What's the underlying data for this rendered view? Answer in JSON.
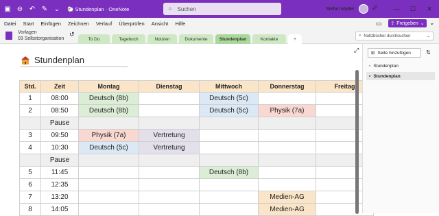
{
  "app": {
    "title": "Stundenplan",
    "app_name": "OneNote",
    "separator": "·"
  },
  "search": {
    "placeholder": "Suchen"
  },
  "user": {
    "name": "Stefan Malter"
  },
  "menu": [
    "Datei",
    "Start",
    "Einfügen",
    "Zeichnen",
    "Verlauf",
    "Überprüfen",
    "Ansicht",
    "Hilfe"
  ],
  "share_label": "Freigeben",
  "notebook": {
    "line1": "Vorlagen",
    "line2": "03 Selbstorganisation"
  },
  "tabs": [
    {
      "label": "To Do",
      "color": "#cfe8c4"
    },
    {
      "label": "Tagebuch",
      "color": "#cfe8c4"
    },
    {
      "label": "Notizen",
      "color": "#cfe8c4"
    },
    {
      "label": "Dokumente",
      "color": "#cfe8c4"
    },
    {
      "label": "Stundenplan",
      "color": "#a9d89a",
      "active": true
    },
    {
      "label": "Kontakte",
      "color": "#cfe8c4"
    },
    {
      "label": "+",
      "color": "#ffffff"
    }
  ],
  "notebook_search": {
    "placeholder": "Notizbücher durchsuchen"
  },
  "page": {
    "title": "Stundenplan"
  },
  "table": {
    "headers": [
      "Std.",
      "Zeit",
      "Montag",
      "Dienstag",
      "Mittwoch",
      "Donnerstag",
      "Freitag"
    ],
    "rows": [
      {
        "std": "1",
        "zeit": "08:00",
        "cells": [
          {
            "t": "Deutsch (8b)",
            "c": "green"
          },
          {
            "t": "",
            "c": ""
          },
          {
            "t": "Deutsch (5c)",
            "c": "blue"
          },
          {
            "t": "",
            "c": ""
          },
          {
            "t": "",
            "c": ""
          }
        ]
      },
      {
        "std": "2",
        "zeit": "08:50",
        "cells": [
          {
            "t": "Deutsch (8b)",
            "c": "green"
          },
          {
            "t": "",
            "c": ""
          },
          {
            "t": "Deutsch (5c)",
            "c": "blue"
          },
          {
            "t": "Physik (7a)",
            "c": "red"
          },
          {
            "t": "",
            "c": ""
          }
        ]
      },
      {
        "pause": true,
        "zeit": "Pause"
      },
      {
        "std": "3",
        "zeit": "09:50",
        "cells": [
          {
            "t": "Physik (7a)",
            "c": "red"
          },
          {
            "t": "Vertretung",
            "c": "purple"
          },
          {
            "t": "",
            "c": ""
          },
          {
            "t": "",
            "c": ""
          },
          {
            "t": "",
            "c": ""
          }
        ]
      },
      {
        "std": "4",
        "zeit": "10:30",
        "cells": [
          {
            "t": "Deutsch (5c)",
            "c": "blue"
          },
          {
            "t": "Vertretung",
            "c": "purple"
          },
          {
            "t": "",
            "c": ""
          },
          {
            "t": "",
            "c": ""
          },
          {
            "t": "",
            "c": ""
          }
        ]
      },
      {
        "pause": true,
        "zeit": "Pause"
      },
      {
        "std": "5",
        "zeit": "11:45",
        "cells": [
          {
            "t": "",
            "c": ""
          },
          {
            "t": "",
            "c": ""
          },
          {
            "t": "Deutsch (8b)",
            "c": "green"
          },
          {
            "t": "",
            "c": ""
          },
          {
            "t": "",
            "c": ""
          }
        ]
      },
      {
        "std": "6",
        "zeit": "12:35",
        "cells": [
          {
            "t": "",
            "c": ""
          },
          {
            "t": "",
            "c": ""
          },
          {
            "t": "",
            "c": ""
          },
          {
            "t": "",
            "c": ""
          },
          {
            "t": "",
            "c": ""
          }
        ]
      },
      {
        "std": "7",
        "zeit": "13:20",
        "cells": [
          {
            "t": "",
            "c": ""
          },
          {
            "t": "",
            "c": ""
          },
          {
            "t": "",
            "c": ""
          },
          {
            "t": "Medien-AG",
            "c": "orange"
          },
          {
            "t": "",
            "c": ""
          }
        ]
      },
      {
        "std": "8",
        "zeit": "14:05",
        "cells": [
          {
            "t": "",
            "c": ""
          },
          {
            "t": "",
            "c": ""
          },
          {
            "t": "",
            "c": ""
          },
          {
            "t": "Medien-AG",
            "c": "orange"
          },
          {
            "t": "",
            "c": ""
          }
        ]
      }
    ]
  },
  "sidebar": {
    "add_page": "Seite hinzufügen",
    "pages": [
      "Stundenplan",
      "Stundenplan"
    ]
  }
}
